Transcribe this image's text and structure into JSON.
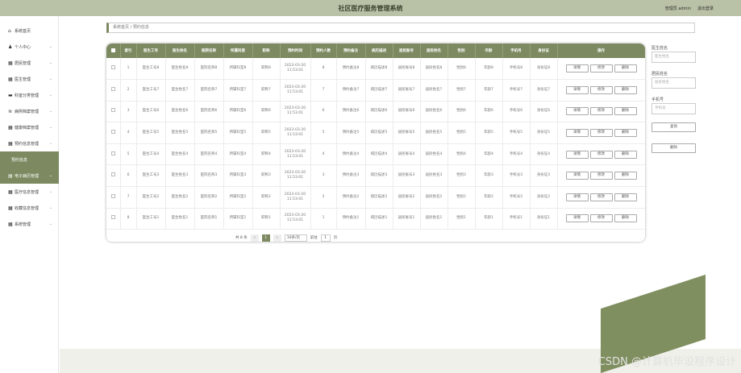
{
  "header": {
    "title": "社区医疗服务管理系统",
    "user": "管理员 admin",
    "logout": "退出登录"
  },
  "sidebar": {
    "items": [
      {
        "label": "系统首页",
        "icon": "home-icon",
        "glyph": "⌂",
        "chev": ""
      },
      {
        "label": "个人中心",
        "icon": "user-icon",
        "glyph": "♟",
        "chev": "⌄"
      },
      {
        "label": "居民管理",
        "icon": "grid-icon",
        "glyph": "▦",
        "chev": "⌄"
      },
      {
        "label": "医生管理",
        "icon": "grid-icon",
        "glyph": "▦",
        "chev": "⌄"
      },
      {
        "label": "科室分类管理",
        "icon": "monitor-icon",
        "glyph": "▬",
        "chev": "⌄"
      },
      {
        "label": "病例档案管理",
        "icon": "chart-icon",
        "glyph": "≋",
        "chev": "⌄"
      },
      {
        "label": "健康档案管理",
        "icon": "grid-icon",
        "glyph": "▦",
        "chev": "⌄"
      },
      {
        "label": "预约信息管理",
        "icon": "grid-icon",
        "glyph": "▦",
        "chev": "⌄"
      },
      {
        "label": "预约信息",
        "icon": "",
        "glyph": "",
        "chev": ""
      },
      {
        "label": "电子病历管理",
        "icon": "file-icon",
        "glyph": "▤",
        "chev": "⌄"
      },
      {
        "label": "医疗信息管理",
        "icon": "grid-icon",
        "glyph": "▦",
        "chev": "⌄"
      },
      {
        "label": "收藏信息管理",
        "icon": "grid-icon",
        "glyph": "▦",
        "chev": "⌄"
      },
      {
        "label": "系统管理",
        "icon": "grid-icon",
        "glyph": "▦",
        "chev": "⌄"
      }
    ]
  },
  "breadcrumb": {
    "home": "系统首页",
    "sep": "/",
    "current": "预约信息"
  },
  "table": {
    "headers": [
      "索引",
      "医生工号",
      "医生姓名",
      "医院名称",
      "所属科室",
      "职称",
      "预约时间",
      "预约人数",
      "预约备注",
      "病历描述",
      "居民账号",
      "居民姓名",
      "性别",
      "年龄",
      "手机号",
      "身份证",
      "操作"
    ],
    "rows": [
      [
        "1",
        "医生工号8",
        "医生姓名8",
        "医院名称8",
        "所属科室8",
        "职称8",
        "2023-03-20 11:53:01",
        "8",
        "预约备注8",
        "病历描述8",
        "居民账号8",
        "居民姓名8",
        "性别8",
        "年龄8",
        "手机号8",
        "身份证8"
      ],
      [
        "2",
        "医生工号7",
        "医生姓名7",
        "医院名称7",
        "所属科室7",
        "职称7",
        "2023-03-20 11:53:01",
        "7",
        "预约备注7",
        "病历描述7",
        "居民账号7",
        "居民姓名7",
        "性别7",
        "年龄7",
        "手机号7",
        "身份证7"
      ],
      [
        "3",
        "医生工号6",
        "医生姓名6",
        "医院名称6",
        "所属科室6",
        "职称6",
        "2023-03-20 11:53:01",
        "6",
        "预约备注6",
        "病历描述6",
        "居民账号6",
        "居民姓名6",
        "性别6",
        "年龄6",
        "手机号6",
        "身份证6"
      ],
      [
        "4",
        "医生工号5",
        "医生姓名5",
        "医院名称5",
        "所属科室5",
        "职称5",
        "2023-03-20 11:53:01",
        "5",
        "预约备注5",
        "病历描述5",
        "居民账号5",
        "居民姓名5",
        "性别5",
        "年龄5",
        "手机号5",
        "身份证5"
      ],
      [
        "5",
        "医生工号4",
        "医生姓名4",
        "医院名称4",
        "所属科室4",
        "职称4",
        "2023-03-20 11:53:01",
        "4",
        "预约备注4",
        "病历描述4",
        "居民账号4",
        "居民姓名4",
        "性别4",
        "年龄4",
        "手机号4",
        "身份证4"
      ],
      [
        "6",
        "医生工号3",
        "医生姓名3",
        "医院名称3",
        "所属科室3",
        "职称3",
        "2023-03-20 11:53:01",
        "3",
        "预约备注3",
        "病历描述3",
        "居民账号3",
        "居民姓名3",
        "性别3",
        "年龄3",
        "手机号3",
        "身份证3"
      ],
      [
        "7",
        "医生工号2",
        "医生姓名2",
        "医院名称2",
        "所属科室2",
        "职称2",
        "2023-03-20 11:53:01",
        "2",
        "预约备注2",
        "病历描述2",
        "居民账号2",
        "居民姓名2",
        "性别2",
        "年龄2",
        "手机号2",
        "身份证2"
      ],
      [
        "8",
        "医生工号1",
        "医生姓名1",
        "医院名称1",
        "所属科室1",
        "职称1",
        "2023-03-20 11:53:01",
        "1",
        "预约备注1",
        "病历描述1",
        "居民账号1",
        "居民姓名1",
        "性别1",
        "年龄1",
        "手机号1",
        "身份证1"
      ]
    ],
    "actions": [
      "详情",
      "修改",
      "删除"
    ]
  },
  "pager": {
    "total": "共 8 条",
    "prev": "<",
    "page": "1",
    "next": ">",
    "size": "10条/页",
    "goto": "前往",
    "goto_value": "1",
    "page_unit": "页"
  },
  "search": {
    "fields": [
      {
        "label": "医生姓名",
        "placeholder": "医生姓名"
      },
      {
        "label": "居民姓名",
        "placeholder": "居民姓名"
      },
      {
        "label": "手机号",
        "placeholder": "手机号"
      }
    ],
    "query_button": "查询",
    "delete_button": "删除"
  },
  "watermark": "CSDN @计算机毕设程序设计"
}
